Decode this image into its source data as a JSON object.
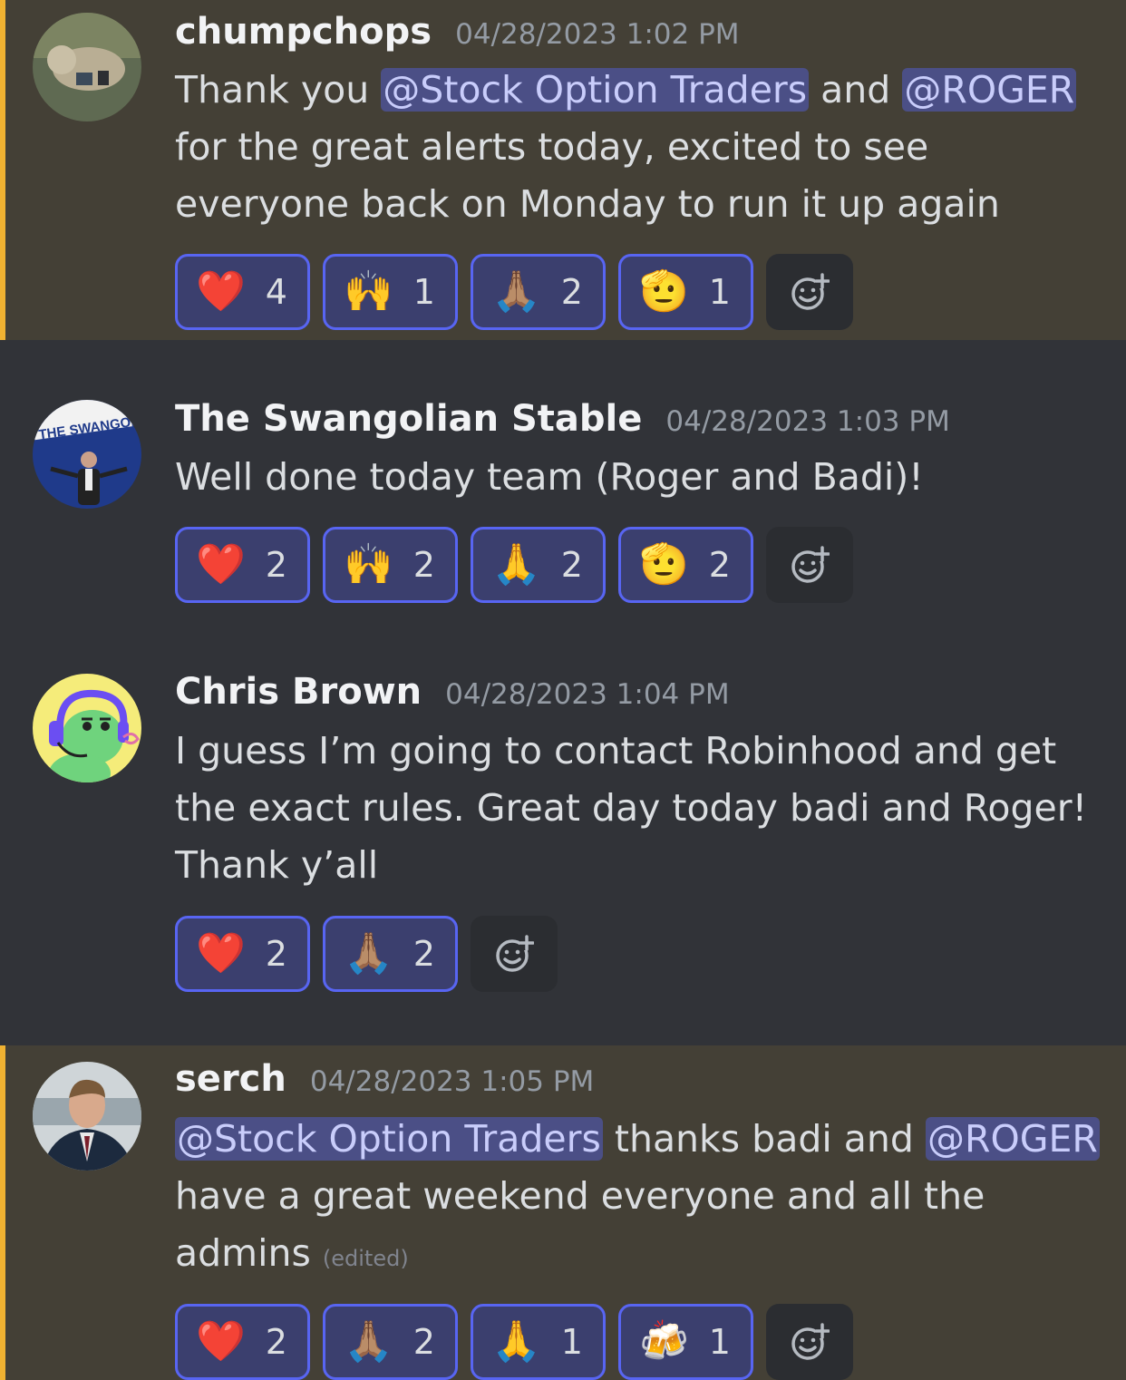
{
  "messages": [
    {
      "username": "chumpchops",
      "timestamp": "04/28/2023 1:02 PM",
      "avatar_icon": "monkey-photo",
      "text": {
        "t1": "Thank you ",
        "m1": "@Stock Option Traders",
        "t2": " and ",
        "m2": "@ROGER",
        "t3": " for the great alerts today, excited to see everyone back on Monday to run it up again"
      },
      "reactions": [
        {
          "emoji": "❤️",
          "icon": "heart-icon",
          "count": "4"
        },
        {
          "emoji": "🙌",
          "icon": "raised-hands-icon",
          "count": "1"
        },
        {
          "emoji": "🙏🏽",
          "icon": "folded-hands-icon",
          "count": "2"
        },
        {
          "emoji": "🫡",
          "icon": "saluting-face-icon",
          "count": "1"
        }
      ]
    },
    {
      "username": "The Swangolian Stable",
      "timestamp": "04/28/2023 1:03 PM",
      "avatar_text": "THE SWANGOLIA",
      "text": "Well done today team (Roger and Badi)!",
      "reactions": [
        {
          "emoji": "❤️",
          "icon": "heart-icon",
          "count": "2"
        },
        {
          "emoji": "🙌",
          "icon": "raised-hands-icon",
          "count": "2"
        },
        {
          "emoji": "🙏",
          "icon": "folded-hands-icon",
          "count": "2"
        },
        {
          "emoji": "🫡",
          "icon": "saluting-face-icon",
          "count": "2"
        }
      ]
    },
    {
      "username": "Chris Brown",
      "timestamp": "04/28/2023 1:04 PM",
      "avatar_icon": "cartoon-headset",
      "text": "I guess I’m going to contact Robinhood and get the exact rules. Great day today badi and Roger! Thank y’all",
      "reactions": [
        {
          "emoji": "❤️",
          "icon": "heart-icon",
          "count": "2"
        },
        {
          "emoji": "🙏🏽",
          "icon": "folded-hands-icon",
          "count": "2"
        }
      ]
    },
    {
      "username": "serch",
      "timestamp": "04/28/2023 1:05 PM",
      "avatar_icon": "man-in-suit-photo",
      "text": {
        "m1": "@Stock Option Traders",
        "t1": " thanks badi and ",
        "m2": "@ROGER",
        "t2": " have a great weekend everyone and all the admins",
        "edited": "(edited)"
      },
      "reactions": [
        {
          "emoji": "❤️",
          "icon": "heart-icon",
          "count": "2"
        },
        {
          "emoji": "🙏🏽",
          "icon": "folded-hands-icon",
          "count": "2"
        },
        {
          "emoji": "🙏",
          "icon": "folded-hands-icon",
          "count": "1"
        },
        {
          "emoji": "🍻",
          "icon": "beer-mugs-icon",
          "count": "1"
        }
      ]
    }
  ],
  "colors": {
    "background": "#313338",
    "mention_highlight": "#444036",
    "mention_bar": "#f0b232",
    "reaction_border": "#5865f2",
    "mention_pill": "#4b4f86"
  }
}
